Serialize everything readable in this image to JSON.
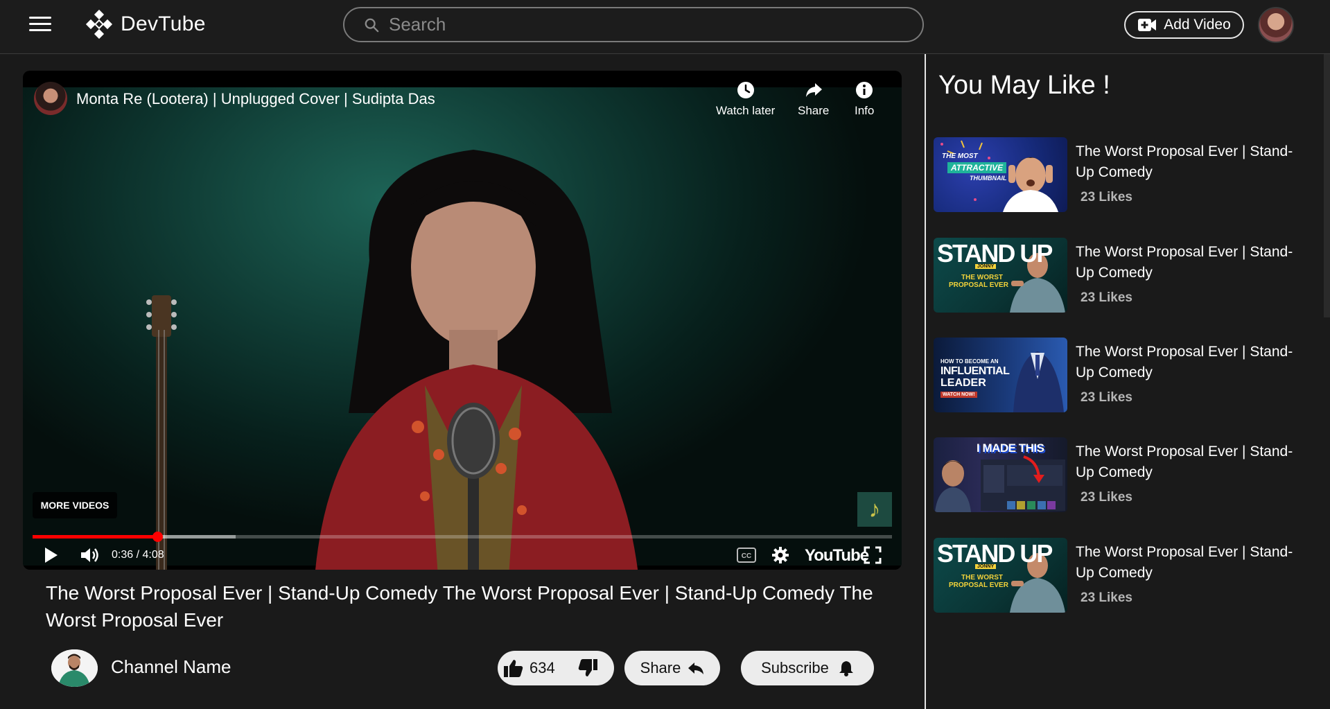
{
  "header": {
    "brand": "DevTube",
    "search_placeholder": "Search",
    "add_video_label": "Add Video"
  },
  "player": {
    "video_title": "Monta Re (Lootera) | Unplugged Cover | Sudipta Das",
    "watch_later_label": "Watch later",
    "share_label": "Share",
    "info_label": "Info",
    "more_videos_label": "MORE VIDEOS",
    "time_display": "0:36 / 4:08",
    "played_fraction": 0.145,
    "buffered_fraction": 0.236,
    "youtube_wordmark": "YouTube"
  },
  "video": {
    "title": "The Worst Proposal Ever | Stand-Up Comedy The Worst Proposal Ever | Stand-Up Comedy The Worst Proposal Ever",
    "channel_name": "Channel Name",
    "like_count": "634",
    "share_label": "Share",
    "subscribe_label": "Subscribe"
  },
  "sidebar": {
    "heading": "You May Like !",
    "items": [
      {
        "title": "The Worst Proposal Ever | Stand-Up Comedy",
        "likes": "23 Likes",
        "thumb": "attractive-thumbnail"
      },
      {
        "title": "The Worst Proposal Ever | Stand-Up Comedy",
        "likes": "23 Likes",
        "thumb": "stand-up"
      },
      {
        "title": "The Worst Proposal Ever | Stand-Up Comedy",
        "likes": "23 Likes",
        "thumb": "influential-leader"
      },
      {
        "title": "The Worst Proposal Ever | Stand-Up Comedy",
        "likes": "23 Likes",
        "thumb": "i-made-this"
      },
      {
        "title": "The Worst Proposal Ever | Stand-Up Comedy",
        "likes": "23 Likes",
        "thumb": "stand-up"
      }
    ],
    "thumb_text": {
      "t1": [
        "THE MOST",
        "ATTRACTIVE",
        "THUMBNAIL"
      ],
      "t2": [
        "STAND UP",
        "JONNY",
        "THE WORST",
        "PROPOSAL EVER"
      ],
      "t3": [
        "HOW TO BECOME AN",
        "INFLUENTIAL",
        "LEADER",
        "WATCH NOW!"
      ],
      "t4": [
        "I MADE THIS"
      ],
      "t5": [
        "STAND UP",
        "JONNY",
        "THE WORST",
        "PROPOSAL EVER"
      ]
    }
  },
  "colors": {
    "background": "#1a1a1a",
    "accent_red": "#ff0000",
    "pill_bg": "#ececec"
  }
}
